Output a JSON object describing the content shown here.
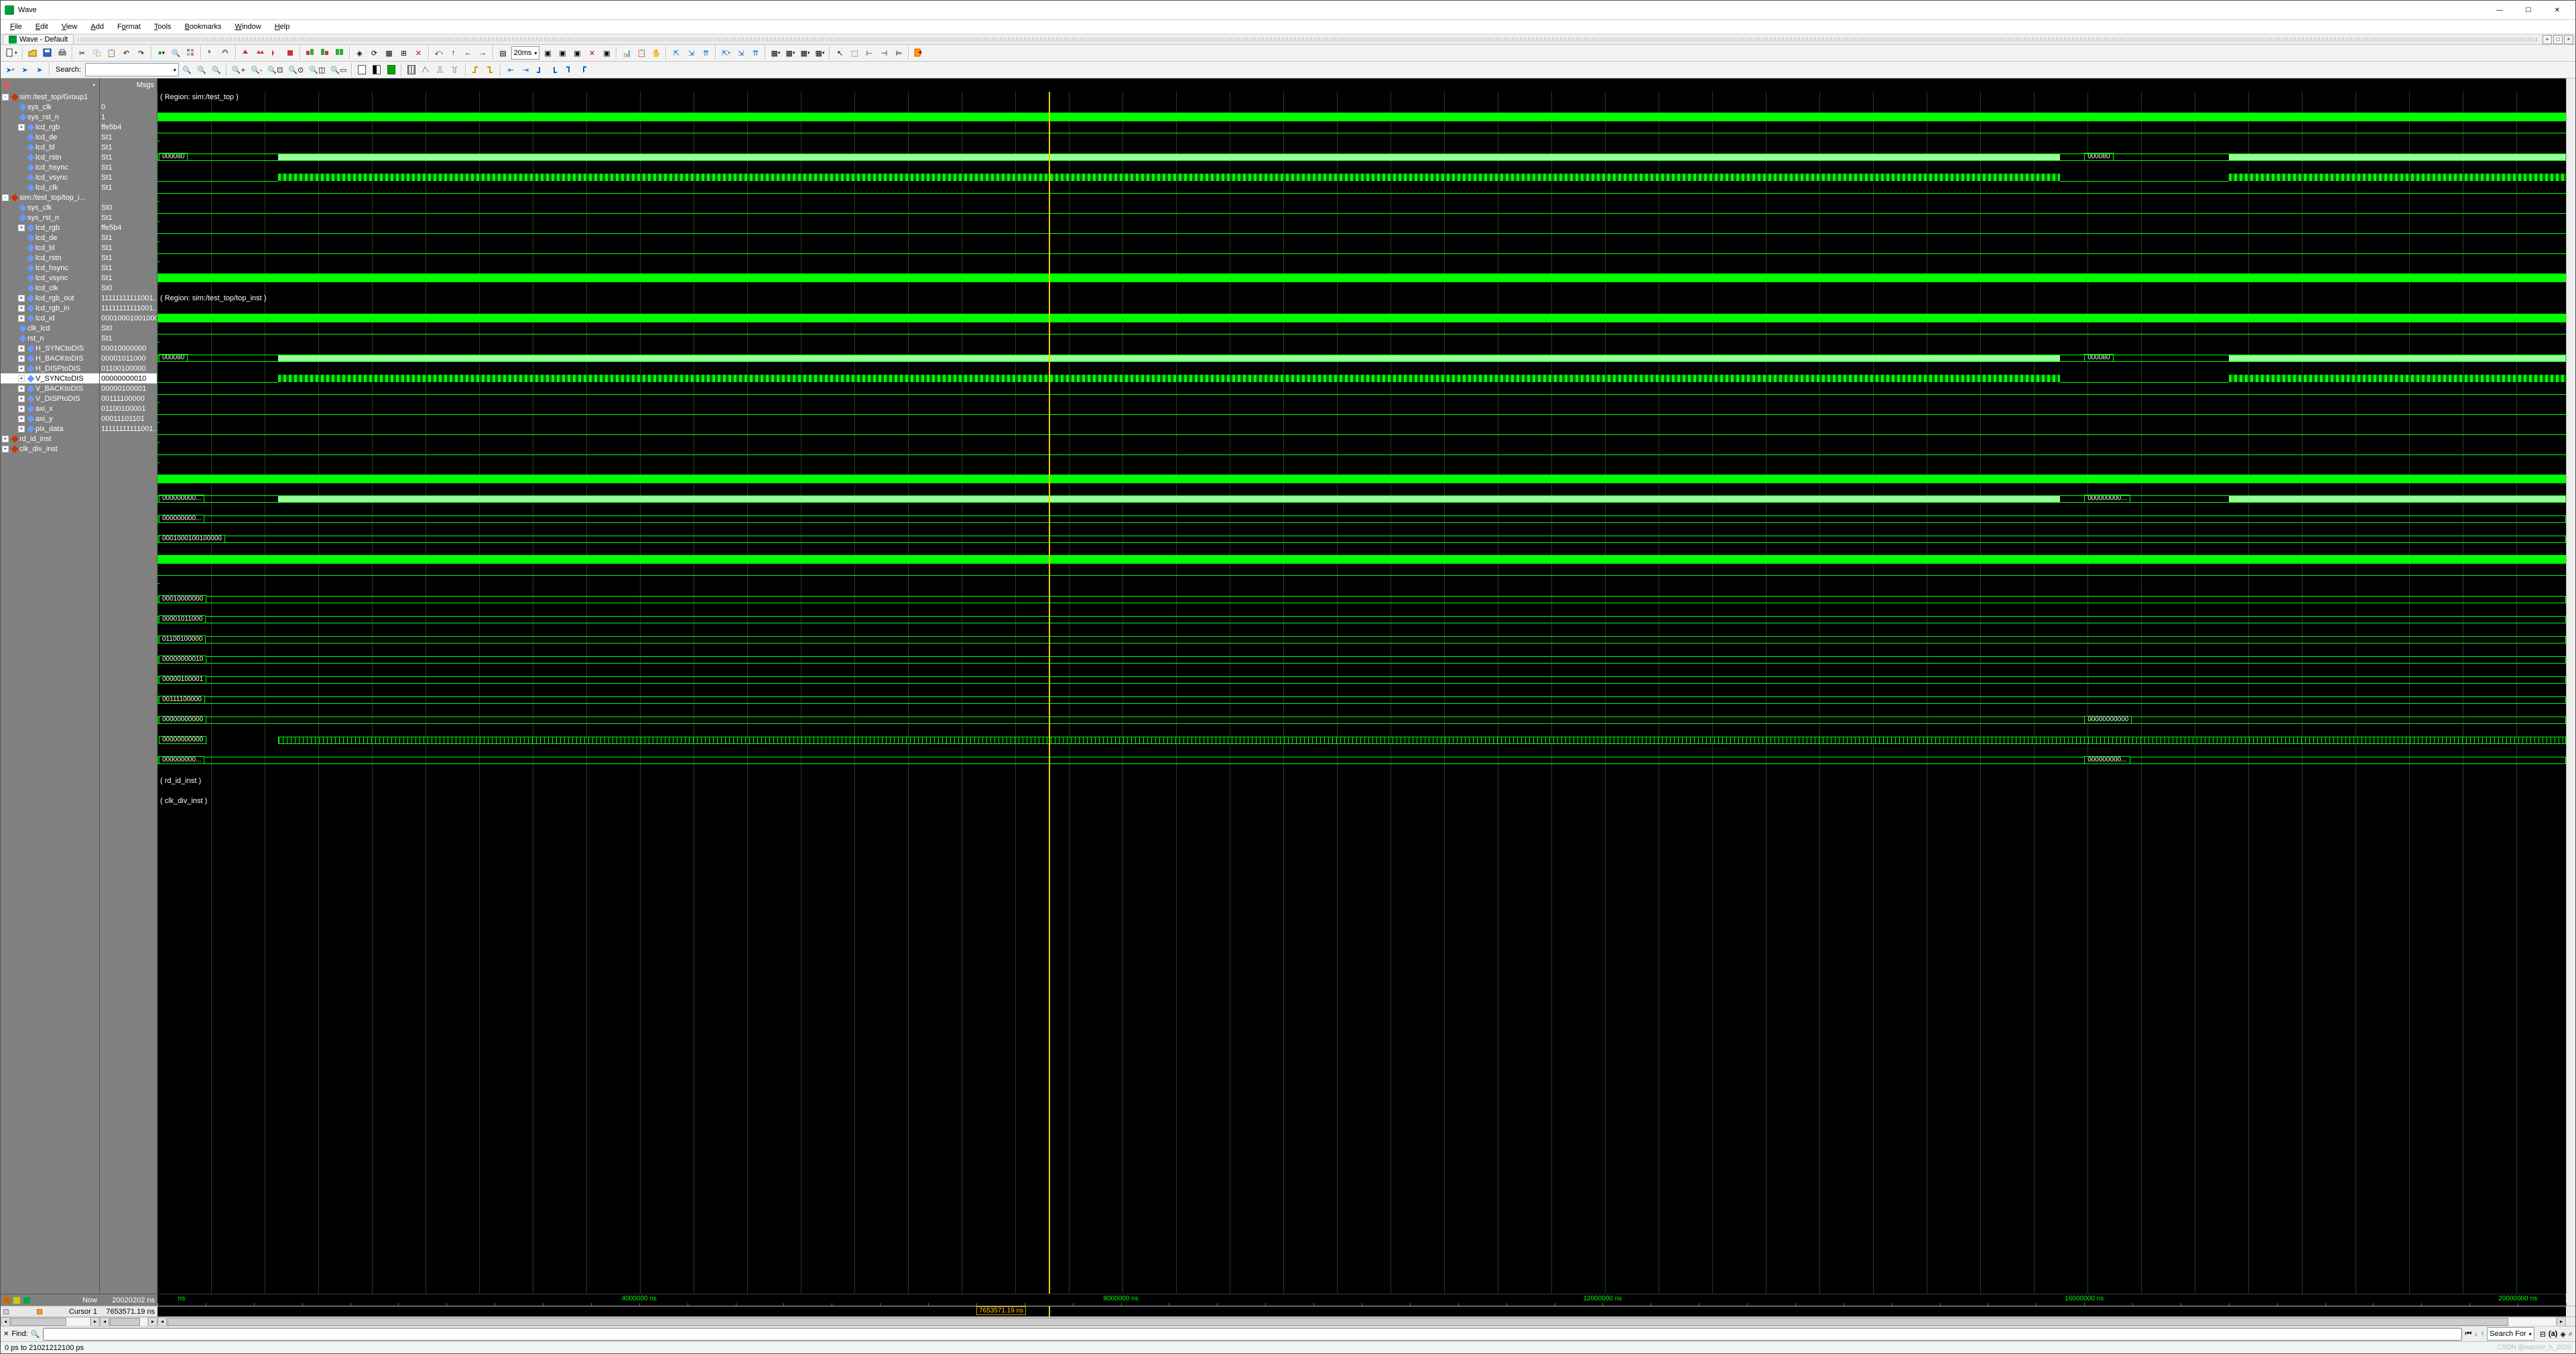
{
  "title": "Wave",
  "docktab": "Wave - Default",
  "menus": [
    {
      "label": "File",
      "ak": "F"
    },
    {
      "label": "Edit",
      "ak": "E"
    },
    {
      "label": "View",
      "ak": "V"
    },
    {
      "label": "Add",
      "ak": "A"
    },
    {
      "label": "Format",
      "ak": "o"
    },
    {
      "label": "Tools",
      "ak": "T"
    },
    {
      "label": "Bookmarks",
      "ak": "B"
    },
    {
      "label": "Window",
      "ak": "W"
    },
    {
      "label": "Help",
      "ak": "H"
    }
  ],
  "search_label": "Search:",
  "time_combo": "20ms",
  "header_msgs": "Msgs",
  "now_label": "Now",
  "now_value": "20020202 ns",
  "cursor_label": "Cursor 1",
  "cursor_value": "7653571.19 ns",
  "cursor_tag": "7653571.19 ns",
  "axis_ticks": [
    "ns",
    "4000000 ns",
    "8000000 ns",
    "12000000 ns",
    "16000000 ns",
    "20000000 ns"
  ],
  "find_label": "Find:",
  "searchfor_label": "Search For",
  "status": "0 ps to 21021212100 ps",
  "watermark": "CSDN @warrior_h_2020",
  "regions": {
    "r1": "( Region: sim:/test_top )",
    "r2": "( Region: sim:/test_top/top_inst )",
    "rd": "( rd_id_inst )",
    "clk": "( clk_div_inst )"
  },
  "signals": [
    {
      "name": "sim:/test_top/Group1",
      "value": "",
      "kind": "group",
      "depth": 0,
      "exp": "-"
    },
    {
      "name": "sys_clk",
      "value": "0",
      "kind": "clk",
      "depth": 1
    },
    {
      "name": "sys_rst_n",
      "value": "1",
      "kind": "hi",
      "depth": 1
    },
    {
      "name": "lcd_rgb",
      "value": "ffe5b4",
      "kind": "bus",
      "depth": 1,
      "exp": "+",
      "buslbl": "000080",
      "bus2": "000080"
    },
    {
      "name": "lcd_de",
      "value": "St1",
      "kind": "toggle",
      "depth": 2
    },
    {
      "name": "lcd_bl",
      "value": "St1",
      "kind": "hi",
      "depth": 2
    },
    {
      "name": "lcd_rstn",
      "value": "St1",
      "kind": "hi",
      "depth": 2
    },
    {
      "name": "lcd_hsync",
      "value": "St1",
      "kind": "hi",
      "depth": 2
    },
    {
      "name": "lcd_vsync",
      "value": "St1",
      "kind": "hi",
      "depth": 2
    },
    {
      "name": "lcd_clk",
      "value": "St1",
      "kind": "clk",
      "depth": 2
    },
    {
      "name": "sim:/test_top/top_i...",
      "value": "",
      "kind": "group",
      "depth": 0,
      "exp": "-"
    },
    {
      "name": "sys_clk",
      "value": "St0",
      "kind": "clk",
      "depth": 1
    },
    {
      "name": "sys_rst_n",
      "value": "St1",
      "kind": "hi",
      "depth": 1
    },
    {
      "name": "lcd_rgb",
      "value": "ffe5b4",
      "kind": "bus",
      "depth": 1,
      "exp": "+",
      "buslbl": "000080",
      "bus2": "000080"
    },
    {
      "name": "lcd_de",
      "value": "St1",
      "kind": "toggle",
      "depth": 2
    },
    {
      "name": "lcd_bl",
      "value": "St1",
      "kind": "hi",
      "depth": 2
    },
    {
      "name": "lcd_rstn",
      "value": "St1",
      "kind": "hi",
      "depth": 2
    },
    {
      "name": "lcd_hsync",
      "value": "St1",
      "kind": "hi",
      "depth": 2
    },
    {
      "name": "lcd_vsync",
      "value": "St1",
      "kind": "hi",
      "depth": 2
    },
    {
      "name": "lcd_clk",
      "value": "St0",
      "kind": "clk",
      "depth": 2
    },
    {
      "name": "lcd_rgb_out",
      "value": "11111111111001...",
      "kind": "bus",
      "depth": 1,
      "exp": "+",
      "buslbl": "000000000...",
      "bus2": "000000000..."
    },
    {
      "name": "lcd_rgb_in",
      "value": "11111111111001...",
      "kind": "bus",
      "depth": 1,
      "exp": "+",
      "buslbl": "000000000..."
    },
    {
      "name": "lcd_id",
      "value": "0001000100100000",
      "kind": "bus",
      "depth": 1,
      "exp": "+",
      "buslbl": "0001000100100000"
    },
    {
      "name": "clk_lcd",
      "value": "St0",
      "kind": "clk",
      "depth": 1
    },
    {
      "name": "rst_n",
      "value": "St1",
      "kind": "hi",
      "depth": 1
    },
    {
      "name": "H_SYNCtoDIS",
      "value": "00010000000",
      "kind": "bus",
      "depth": 1,
      "exp": "+",
      "buslbl": "00010000000"
    },
    {
      "name": "H_BACKtoDIS",
      "value": "00001011000",
      "kind": "bus",
      "depth": 1,
      "exp": "+",
      "buslbl": "00001011000"
    },
    {
      "name": "H_DISPtoDIS",
      "value": "01100100000",
      "kind": "bus",
      "depth": 1,
      "exp": "+",
      "buslbl": "01100100000"
    },
    {
      "name": "V_SYNCtoDIS",
      "value": "00000000010",
      "kind": "bus",
      "depth": 1,
      "exp": "+",
      "buslbl": "00000000010",
      "selected": true
    },
    {
      "name": "V_BACKtoDIS",
      "value": "00000100001",
      "kind": "bus",
      "depth": 1,
      "exp": "+",
      "buslbl": "00000100001"
    },
    {
      "name": "V_DISPtoDIS",
      "value": "00111100000",
      "kind": "bus",
      "depth": 1,
      "exp": "+",
      "buslbl": "00111100000"
    },
    {
      "name": "axi_x",
      "value": "01100100001",
      "kind": "bus2",
      "depth": 1,
      "exp": "+",
      "buslbl": "00000000000",
      "bus2": "00000000000"
    },
    {
      "name": "axi_y",
      "value": "00011101101",
      "kind": "dense",
      "depth": 1,
      "exp": "+",
      "buslbl": "00000000000"
    },
    {
      "name": "pix_data",
      "value": "11111111111001...",
      "kind": "bus2",
      "depth": 1,
      "exp": "+",
      "buslbl": "000000000...",
      "bus2": "000000000..."
    },
    {
      "name": "rd_id_inst",
      "value": "",
      "kind": "inst",
      "depth": 0,
      "exp": "+",
      "red": true
    },
    {
      "name": "clk_div_inst",
      "value": "",
      "kind": "inst",
      "depth": 0,
      "exp": "+",
      "red": true
    }
  ]
}
